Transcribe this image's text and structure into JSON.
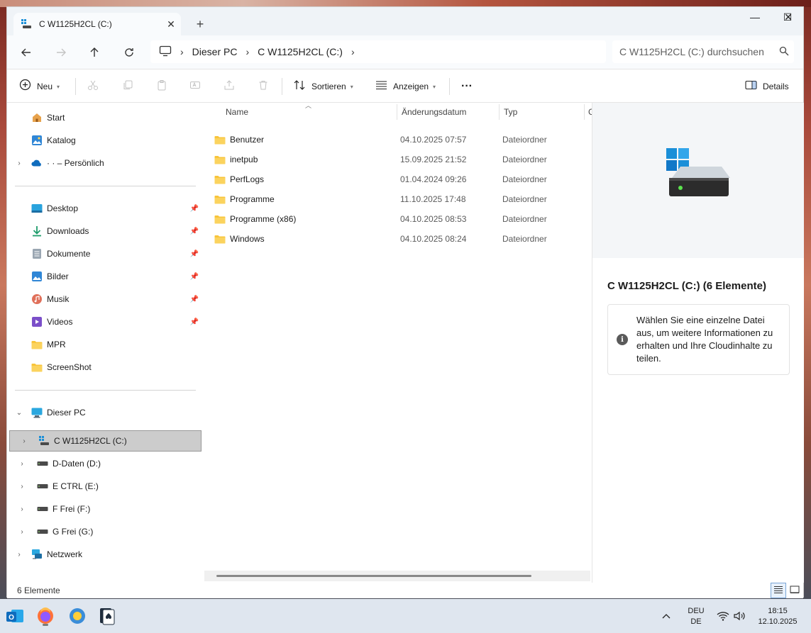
{
  "window": {
    "tab_title": "C W1125H2CL (C:)",
    "new_tab_label": "+",
    "close_tab_glyph": "✕",
    "controls": {
      "minimize": "—",
      "maximize": "☐",
      "close": "✕"
    }
  },
  "navigation": {
    "breadcrumbs": [
      "Dieser PC",
      "C W1125H2CL (C:)"
    ],
    "search_placeholder": "C W1125H2CL (C:) durchsuchen"
  },
  "command_bar": {
    "new_label": "Neu",
    "sort_label": "Sortieren",
    "view_label": "Anzeigen",
    "more_label": "···",
    "details_label": "Details"
  },
  "sidebar": {
    "top_items": [
      {
        "label": "Start",
        "icon": "home-icon"
      },
      {
        "label": "Katalog",
        "icon": "gallery-icon"
      },
      {
        "label": "· · – Persönlich",
        "icon": "onedrive-icon"
      }
    ],
    "quick_access": [
      {
        "label": "Desktop",
        "icon": "desktop-icon",
        "pinned": true
      },
      {
        "label": "Downloads",
        "icon": "download-icon",
        "pinned": true
      },
      {
        "label": "Dokumente",
        "icon": "documents-icon",
        "pinned": true
      },
      {
        "label": "Bilder",
        "icon": "pictures-icon",
        "pinned": true
      },
      {
        "label": "Musik",
        "icon": "music-icon",
        "pinned": true
      },
      {
        "label": "Videos",
        "icon": "videos-icon",
        "pinned": true
      },
      {
        "label": "MPR",
        "icon": "folder-icon",
        "pinned": false
      },
      {
        "label": "ScreenShot",
        "icon": "folder-icon",
        "pinned": false
      }
    ],
    "this_pc": "Dieser PC",
    "drives": [
      {
        "label": "C W1125H2CL (C:)",
        "icon": "windows-drive-icon",
        "selected": true
      },
      {
        "label": "D-Daten (D:)",
        "icon": "drive-icon",
        "selected": false
      },
      {
        "label": "E CTRL (E:)",
        "icon": "drive-icon",
        "selected": false
      },
      {
        "label": "F Frei (F:)",
        "icon": "drive-icon",
        "selected": false
      },
      {
        "label": "G Frei (G:)",
        "icon": "drive-icon",
        "selected": false
      }
    ],
    "network": "Netzwerk"
  },
  "file_list": {
    "columns": {
      "name": "Name",
      "date": "Änderungsdatum",
      "type": "Typ",
      "size": "G"
    },
    "rows": [
      {
        "name": "Benutzer",
        "date": "04.10.2025 07:57",
        "type": "Dateiordner"
      },
      {
        "name": "inetpub",
        "date": "15.09.2025 21:52",
        "type": "Dateiordner"
      },
      {
        "name": "PerfLogs",
        "date": "01.04.2024 09:26",
        "type": "Dateiordner"
      },
      {
        "name": "Programme",
        "date": "11.10.2025 17:48",
        "type": "Dateiordner"
      },
      {
        "name": "Programme (x86)",
        "date": "04.10.2025 08:53",
        "type": "Dateiordner"
      },
      {
        "name": "Windows",
        "date": "04.10.2025 08:24",
        "type": "Dateiordner"
      }
    ]
  },
  "details_pane": {
    "title": "C W1125H2CL (C:) (6 Elemente)",
    "info_text": "Wählen Sie eine einzelne Datei aus, um weitere Informationen zu erhalten und Ihre Cloudinhalte zu teilen."
  },
  "status_bar": {
    "item_count": "6 Elemente"
  },
  "taskbar": {
    "apps": [
      "outlook-icon",
      "firefox-icon",
      "weather-app-icon",
      "solitaire-icon"
    ],
    "lang_line1": "DEU",
    "lang_line2": "DE",
    "time": "18:15",
    "date": "12.10.2025"
  },
  "colors": {
    "accent": "#0067c0",
    "folder": "#f8c43a",
    "selection": "#cccccc"
  }
}
